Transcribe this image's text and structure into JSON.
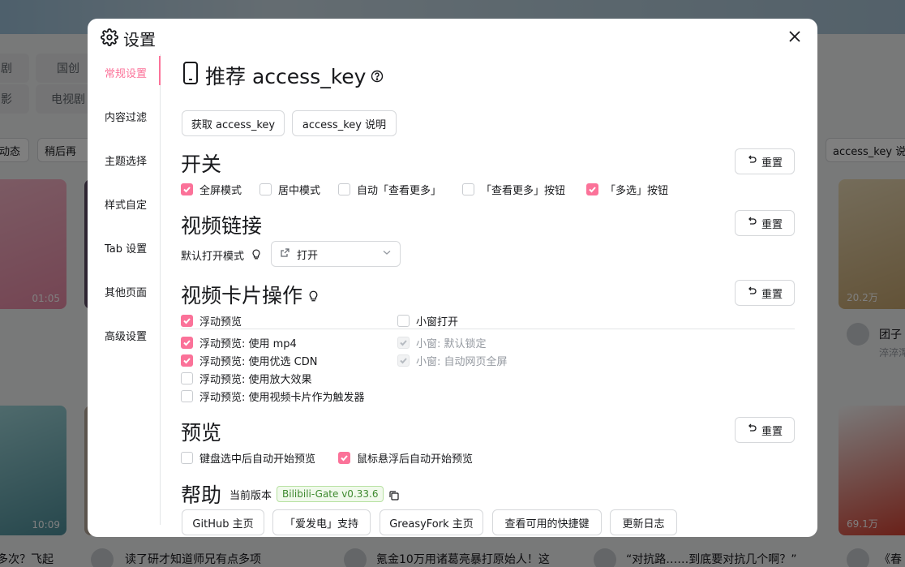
{
  "background": {
    "chips_row1": [
      "剧",
      "国创"
    ],
    "chips_row2": [
      "影",
      "电视剧"
    ],
    "pills": [
      "动态",
      "稍后再"
    ],
    "durations": [
      "01:05",
      "10:09",
      "20.2万",
      "69.1万"
    ],
    "right_label": "access_key 说",
    "author_partial": "团子",
    "author_sub": "淬淬浑",
    "bottom_titles": [
      "多次？飞起",
      "读了研才知道师兄有点多项",
      "氪金10万用诸葛亮暴打原始人！这",
      "“对抗路……到底要对抗几个啊？”",
      "《春"
    ]
  },
  "modal": {
    "title": "设置",
    "sidebar": [
      {
        "label": "常规设置",
        "active": true
      },
      {
        "label": "内容过滤",
        "active": false
      },
      {
        "label": "主题选择",
        "active": false
      },
      {
        "label": "样式自定",
        "active": false
      },
      {
        "label": "Tab 设置",
        "active": false
      },
      {
        "label": "其他页面",
        "active": false
      },
      {
        "label": "高级设置",
        "active": false
      }
    ],
    "access_key": {
      "title": "推荐 access_key",
      "get_button": "获取 access_key",
      "doc_button": "access_key 说明"
    },
    "reset_label": "重置",
    "switches": {
      "title": "开关",
      "options": [
        {
          "label": "全屏模式",
          "checked": true
        },
        {
          "label": "居中模式",
          "checked": false
        },
        {
          "label": "自动「查看更多」",
          "checked": false
        },
        {
          "label": "「查看更多」按钮",
          "checked": false
        },
        {
          "label": "「多选」按钮",
          "checked": true
        }
      ]
    },
    "video_link": {
      "title": "视频链接",
      "label": "默认打开模式",
      "selected": "打开"
    },
    "card_actions": {
      "title": "视频卡片操作",
      "left": [
        {
          "label": "浮动预览",
          "checked": true
        },
        {
          "label": "浮动预览: 使用 mp4",
          "checked": true
        },
        {
          "label": "浮动预览: 使用优选 CDN",
          "checked": true
        },
        {
          "label": "浮动预览: 使用放大效果",
          "checked": false
        },
        {
          "label": "浮动预览: 使用视频卡片作为触发器",
          "checked": false
        }
      ],
      "right": [
        {
          "label": "小窗打开",
          "checked": false,
          "disabled": false
        },
        {
          "label": "小窗: 默认锁定",
          "checked": true,
          "disabled": true
        },
        {
          "label": "小窗: 自动网页全屏",
          "checked": true,
          "disabled": true
        }
      ]
    },
    "preview": {
      "title": "预览",
      "options": [
        {
          "label": "键盘选中后自动开始预览",
          "checked": false
        },
        {
          "label": "鼠标悬浮后自动开始预览",
          "checked": true
        }
      ]
    },
    "help": {
      "title": "帮助",
      "version_label": "当前版本",
      "version": "Bilibili-Gate v0.33.6",
      "buttons": [
        "GitHub 主页",
        "「爱发电」支持",
        "GreasyFork 主页",
        "查看可用的快捷键",
        "更新日志"
      ]
    }
  },
  "colors": {
    "accent": "#fb7299",
    "version_green": "#3e8a2f"
  }
}
